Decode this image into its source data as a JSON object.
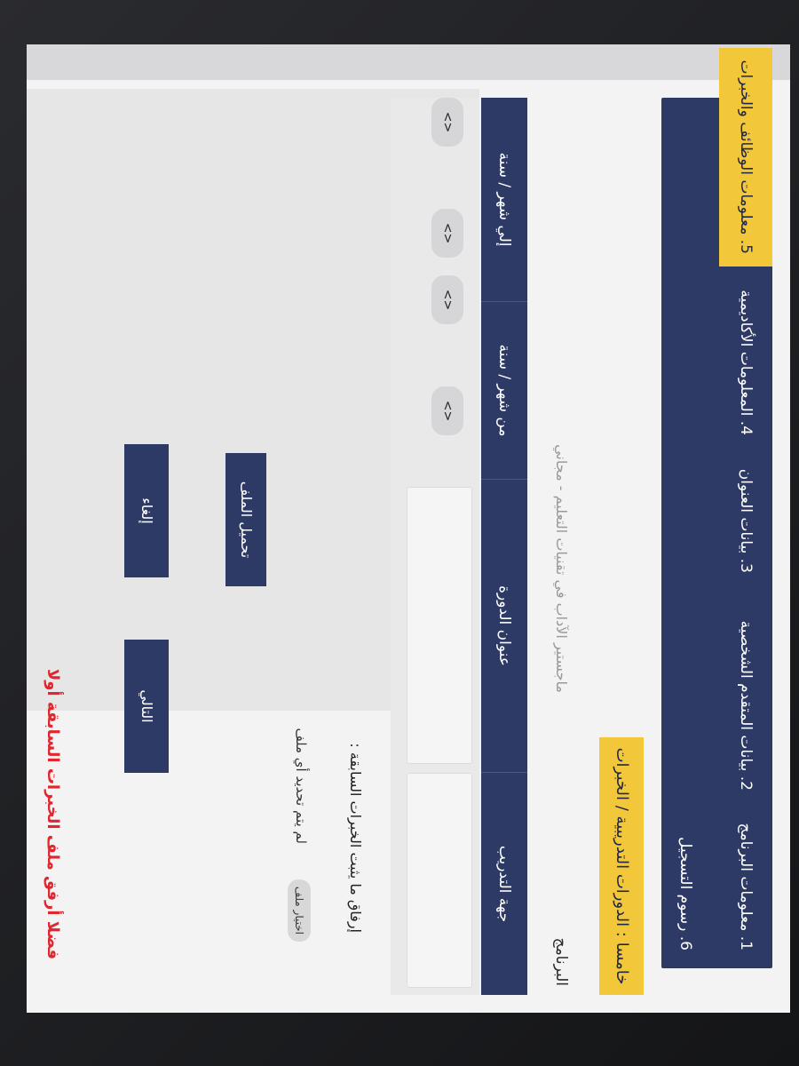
{
  "steps": {
    "s1": "1. معلومات البرنامج",
    "s2": "2. بيانات المتقدم الشخصية",
    "s3": "3. بيانات العنوان",
    "s4": "4. المعلومات الأكاديمية",
    "s5": "5. معلومات الوظائف والخبرات",
    "s6": "6. رسوم التسجيل"
  },
  "section_header": "خامسا : الدورات التدريبية / الخبرات",
  "program": {
    "label": "البرنامج",
    "value": "ماجستير الآداب في تقنيات التعليم - مجاني"
  },
  "table": {
    "headers": [
      "جهة التدريب",
      "عنوان الدورة",
      "من شهر / سنة",
      "إلي شهر / سنة"
    ],
    "stepper_symbol": "<>"
  },
  "attach": {
    "label": "إرفاق ما يثبت الخبرات السابقة :",
    "choose_file": "اختيار ملف",
    "no_file": "لم يتم تحديد أي ملف"
  },
  "buttons": {
    "upload": "تحميل الملف",
    "next": "التالي",
    "cancel": "إلغاء"
  },
  "warning": "فضلا أرفق ملف الخبرات السابقة أولا",
  "colors": {
    "navy": "#2e3a66",
    "yellow": "#f2c73a",
    "warning_red": "#e0262e"
  }
}
